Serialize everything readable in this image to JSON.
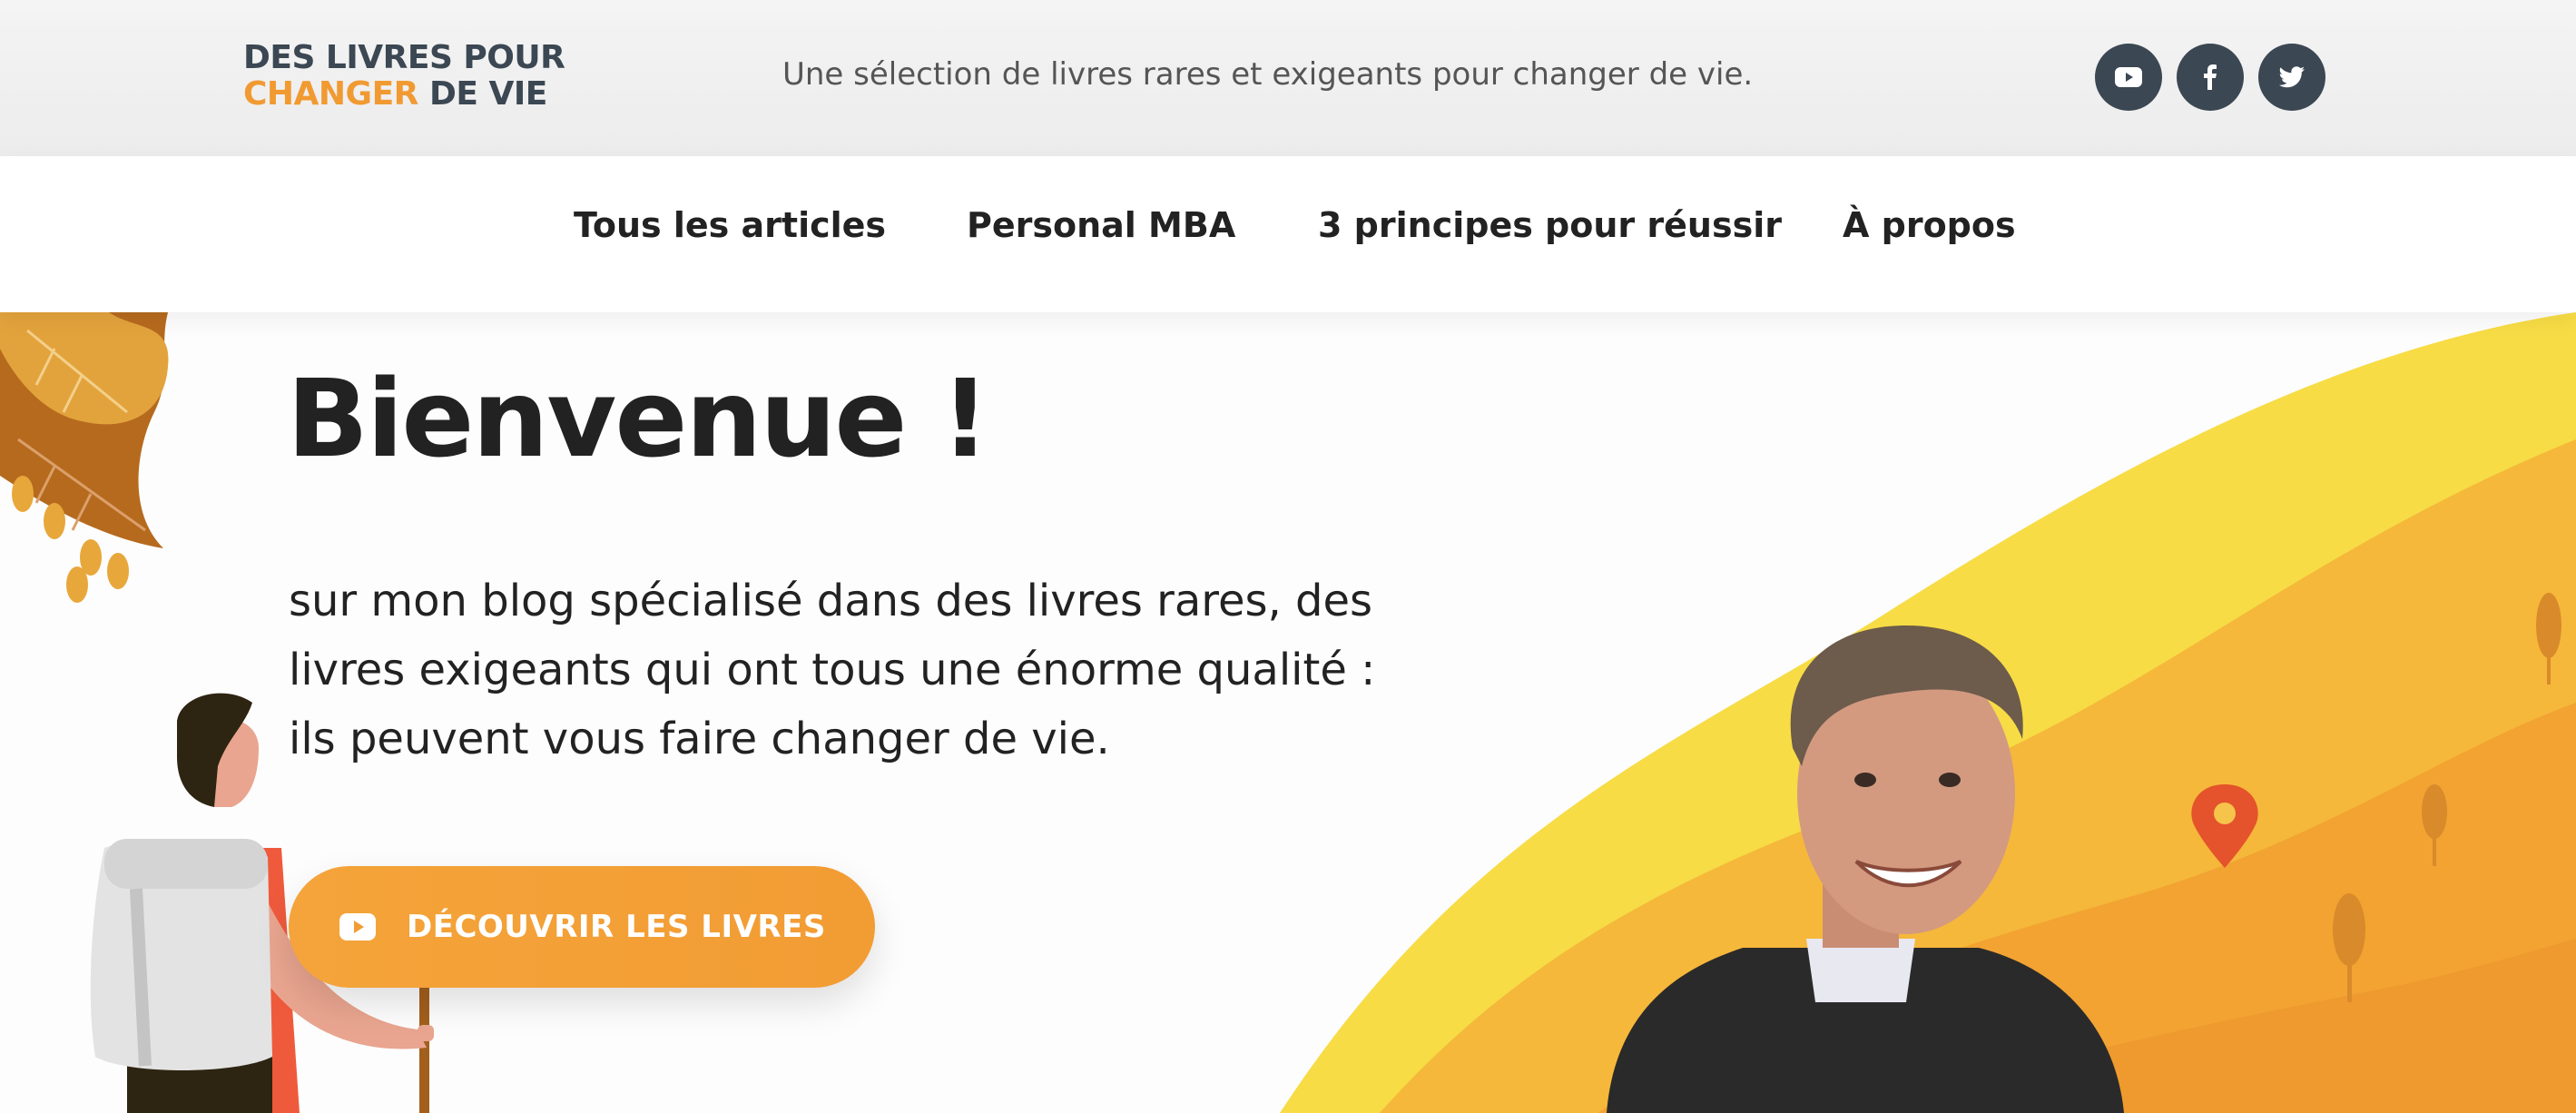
{
  "header": {
    "logo_line1": "DES LIVRES POUR",
    "logo_line2_accent": "CHANGER",
    "logo_line2_rest": "DE VIE",
    "tagline": "Une sélection de livres rares et exigeants pour changer de vie.",
    "socials": [
      {
        "name": "youtube",
        "icon": "youtube-icon"
      },
      {
        "name": "facebook",
        "icon": "facebook-icon"
      },
      {
        "name": "twitter",
        "icon": "twitter-icon"
      }
    ]
  },
  "nav": {
    "items": [
      "Tous les articles",
      "Personal MBA",
      "3 principes pour réussir",
      "À propos"
    ]
  },
  "hero": {
    "title": "Bienvenue !",
    "text_line1": "sur mon blog spécialisé dans des livres rares, des",
    "text_line2": "livres exigeants qui ont tous une énorme qualité :",
    "text_line3": "ils peuvent vous faire changer de vie.",
    "cta_label": "DÉCOUVRIR LES LIVRES",
    "cta_icon": "youtube-icon"
  },
  "colors": {
    "accent": "#f19a32",
    "dark": "#3b4752",
    "hill_yellow": "#f7d43a",
    "hill_orange": "#f2a332"
  }
}
